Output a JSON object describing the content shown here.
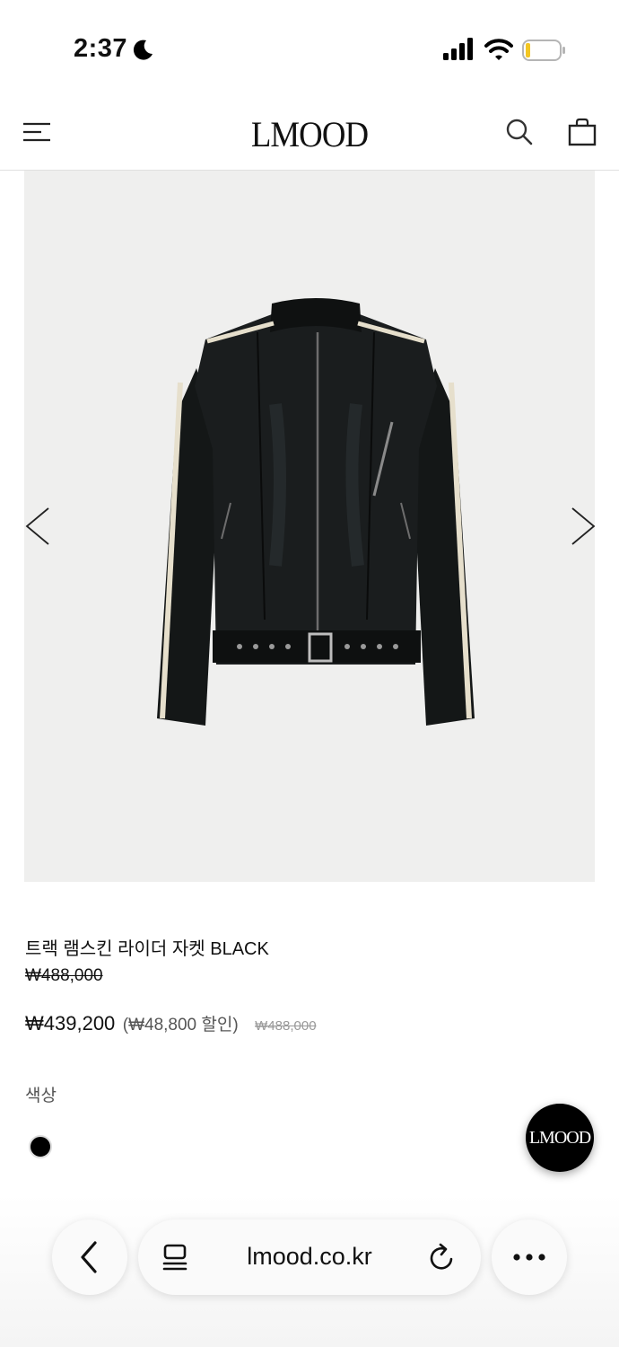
{
  "status": {
    "time": "2:37"
  },
  "header": {
    "logo": "LMOOD"
  },
  "product": {
    "name": "트랙 램스킨 라이더 자켓 BLACK",
    "original_price": "₩488,000",
    "sale_price": "₩439,200",
    "discount": "(₩48,800 할인)",
    "compare_price": "₩488,000",
    "color_label": "색상",
    "selected_color": "#000000"
  },
  "fab": {
    "label": "LMOOD"
  },
  "browser": {
    "url": "lmood.co.kr"
  },
  "icons": [
    "moon-icon",
    "signal-icon",
    "wifi-icon",
    "battery-icon",
    "menu-icon",
    "search-icon",
    "bag-icon",
    "chevron-left-icon",
    "chevron-right-icon",
    "tabs-icon",
    "reload-icon",
    "more-icon"
  ]
}
